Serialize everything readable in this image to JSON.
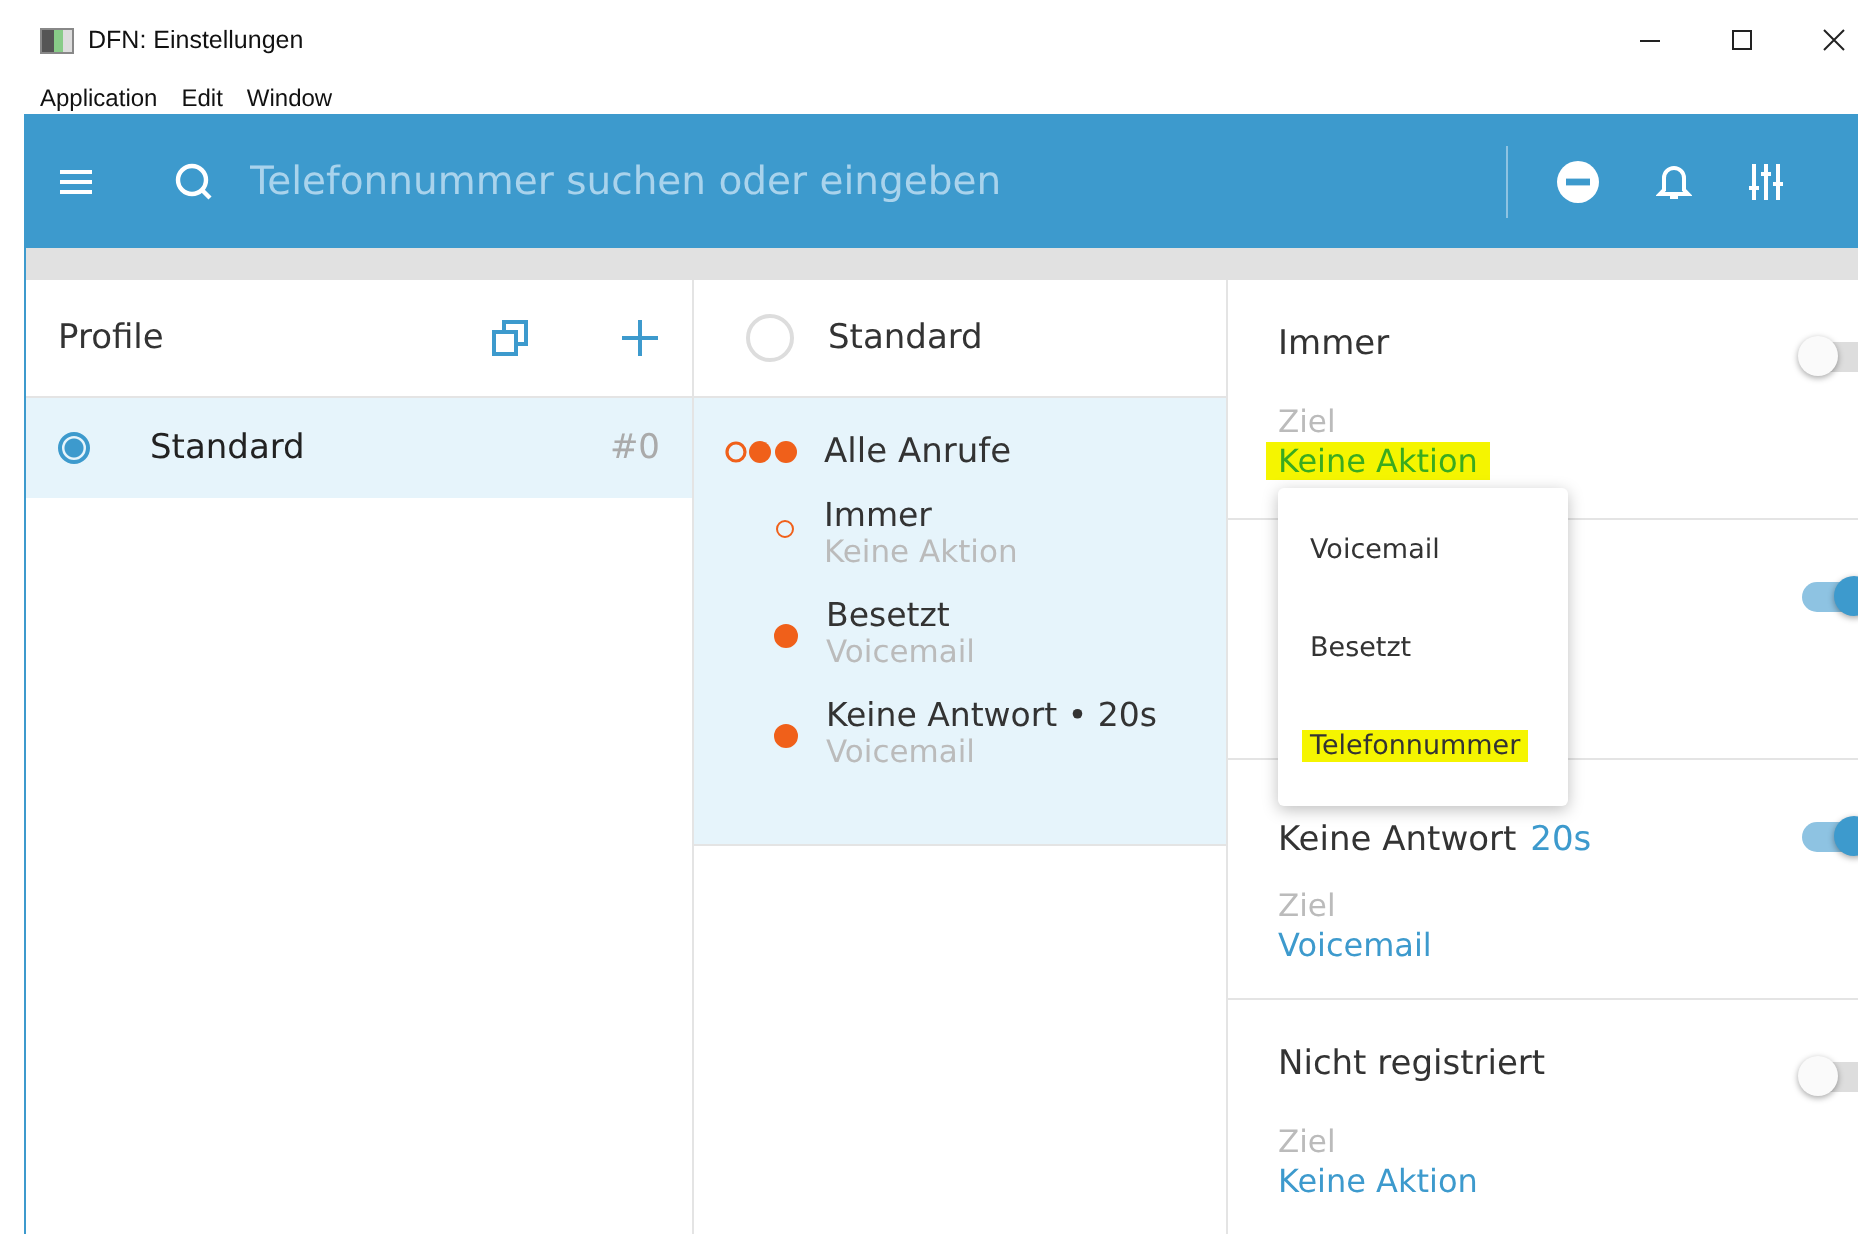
{
  "window": {
    "title": "DFN: Einstellungen"
  },
  "menu_bar": [
    "Application",
    "Edit",
    "Window"
  ],
  "search": {
    "placeholder": "Telefonnummer suchen oder eingeben"
  },
  "profiles": {
    "title": "Profile",
    "items": [
      {
        "name": "Standard",
        "number": "#0",
        "selected": true
      }
    ]
  },
  "rules": {
    "profile": {
      "name": "Standard",
      "selected": false
    },
    "all_label": "Alle Anrufe",
    "items": [
      {
        "title": "Immer",
        "target": "Keine Aktion",
        "active": false
      },
      {
        "title": "Besetzt",
        "target": "Voicemail",
        "active": true
      },
      {
        "title": "Keine Antwort • 20s",
        "target": "Voicemail",
        "active": true
      }
    ]
  },
  "settings": [
    {
      "title": "Immer",
      "label": "Ziel",
      "target": "Keine Aktion",
      "target_highlighted": true,
      "on": false
    },
    {
      "on": true
    },
    {
      "title": "Keine Antwort",
      "delay": "20s",
      "label": "Ziel",
      "target": "Voicemail",
      "target_highlighted": false,
      "on": true
    },
    {
      "title": "Nicht registriert",
      "label": "Ziel",
      "target": "Keine Aktion",
      "target_highlighted": false,
      "on": false
    }
  ],
  "dropdown": {
    "options": [
      {
        "label": "Voicemail",
        "highlighted": false
      },
      {
        "label": "Besetzt",
        "highlighted": false
      },
      {
        "label": "Telefonnummer",
        "highlighted": true
      }
    ]
  }
}
